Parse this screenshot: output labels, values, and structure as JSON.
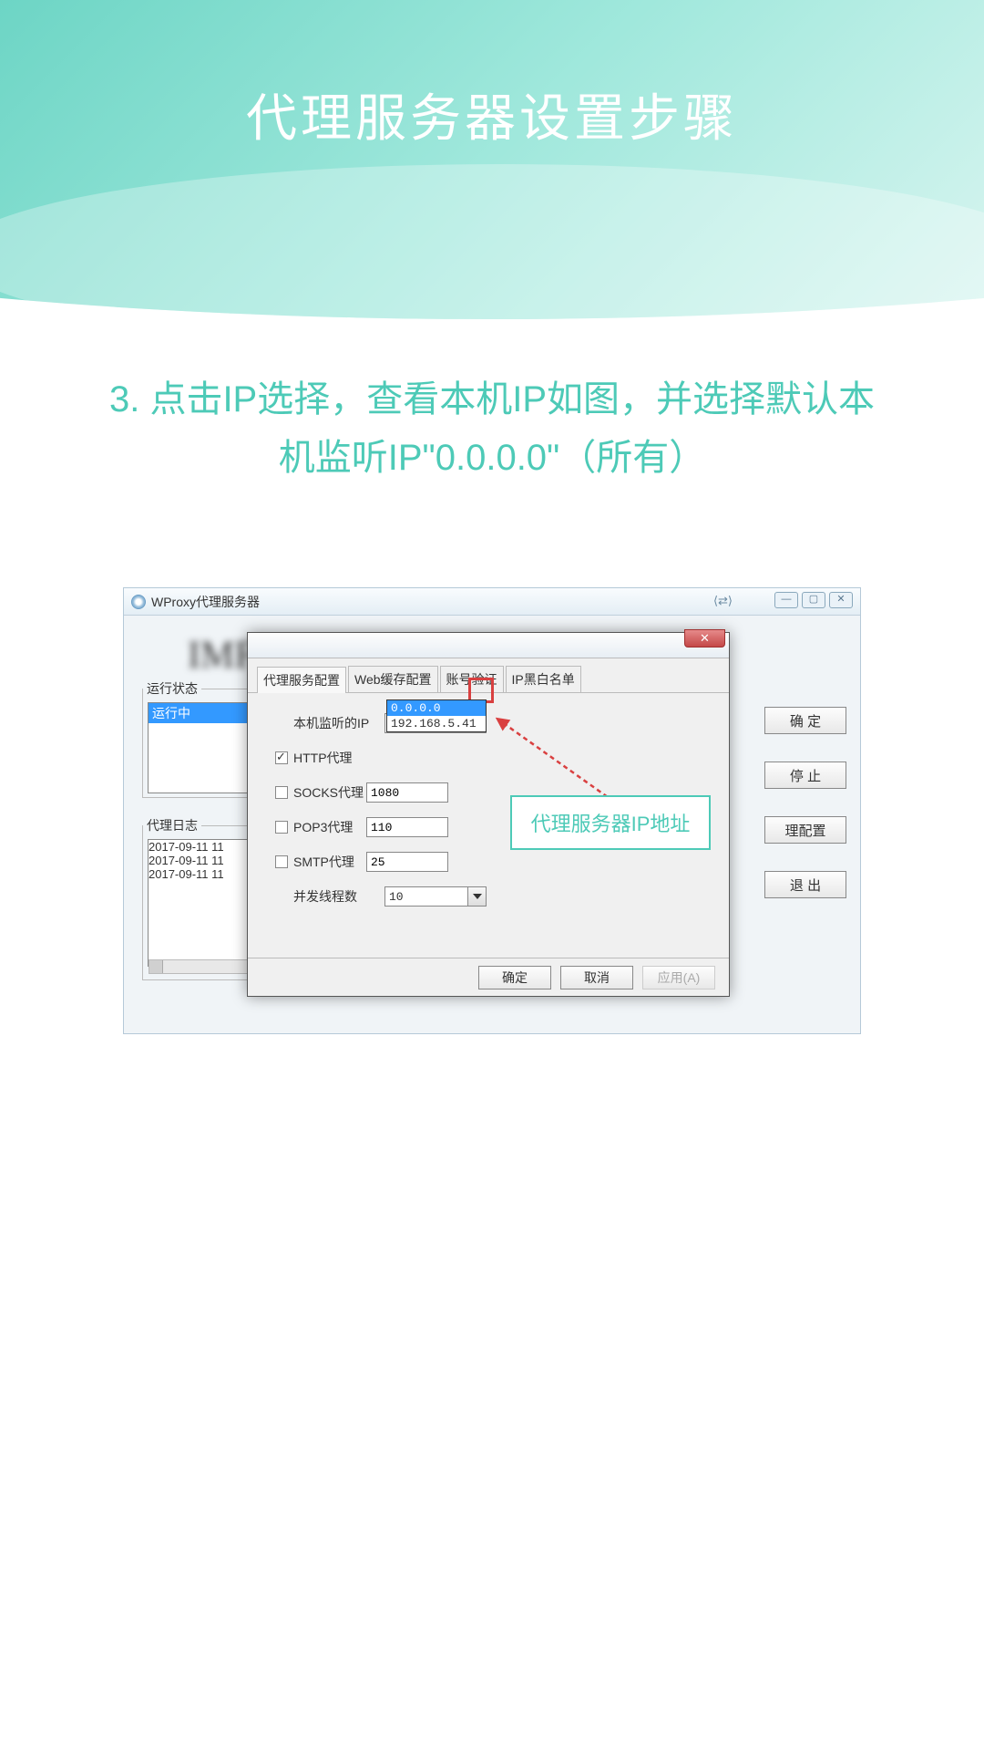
{
  "page_title": "代理服务器设置步骤",
  "instruction": "3. 点击IP选择，查看本机IP如图，并选择默认本机监听IP\"0.0.0.0\"（所有）",
  "window": {
    "title": "WProxy代理服务器",
    "tool_link": "⟨⇄⟩",
    "bg_logo": "IMFirewall"
  },
  "status_panel": {
    "legend": "运行状态",
    "item": "运行中"
  },
  "log_panel": {
    "legend": "代理日志",
    "entries": [
      "2017-09-11 11",
      "2017-09-11 11",
      "2017-09-11 11"
    ]
  },
  "side_buttons": {
    "ok": "确 定",
    "stop": "停 止",
    "config": "理配置",
    "exit": "退 出"
  },
  "dialog": {
    "tabs": [
      "代理服务配置",
      "Web缓存配置",
      "账号验证",
      "IP黑白名单"
    ],
    "fields": {
      "listen_ip_label": "本机监听的IP",
      "listen_ip_value": "0.0.0.0",
      "http_label": "HTTP代理",
      "socks_label": "SOCKS代理",
      "socks_port": "1080",
      "pop3_label": "POP3代理",
      "pop3_port": "110",
      "smtp_label": "SMTP代理",
      "smtp_port": "25",
      "threads_label": "并发线程数",
      "threads_value": "10"
    },
    "dropdown_options": [
      "0.0.0.0",
      "192.168.5.41"
    ],
    "footer": {
      "ok": "确定",
      "cancel": "取消",
      "apply": "应用(A)"
    }
  },
  "callout": "代理服务器IP地址"
}
